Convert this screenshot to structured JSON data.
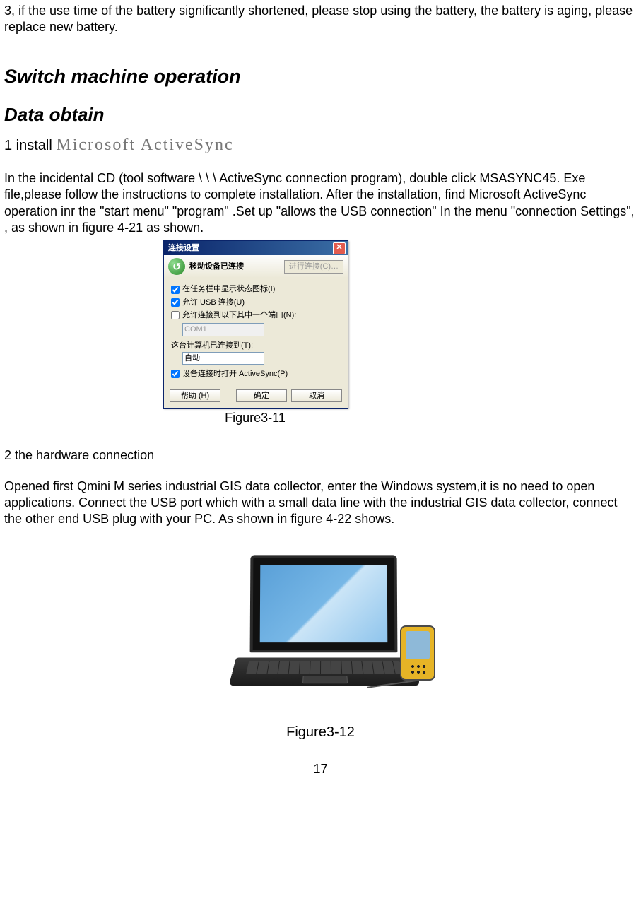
{
  "intro": "3, if the use time of the battery  significantly shortened, please stop using the battery, the battery is aging, please replace new battery.",
  "h1": "Switch machine operation",
  "h1b": "Data  obtain",
  "step1": {
    "prefix": "1 install  ",
    "product": "Microsoft ActiveSync"
  },
  "para1": "In the incidental CD (tool software \\ \\ \\ ActiveSync connection program), double click MSASYNC45. Exe file,please  follow the instructions  to complete installation. After the installation,  find Microsoft ActiveSync operation inr the \"start menu\" \"program\" .Set up \"allows the USB connection\" In the menu \"connection Settings\", , as shown in figure 4-21 as shown.",
  "dialog": {
    "title": "连接设置",
    "status": "移动设备已连接",
    "connect_btn": "进行连接(C)…",
    "opt_tray": "在任务栏中显示状态图标(I)",
    "opt_usb": "允许 USB 连接(U)",
    "opt_port": "允许连接到以下其中一个端口(N):",
    "port_value": "COM1",
    "label_connected": "这台计算机已连接到(T):",
    "connected_value": "自动",
    "opt_open": "设备连接时打开 ActiveSync(P)",
    "btn_help": "帮助 (H)",
    "btn_ok": "确定",
    "btn_cancel": "取消"
  },
  "caption1": "Figure3-11",
  "step2_title": "2  the hardware connection",
  "para2": "Opened first Qmini M series industrial GIS data collector, enter  the Windows system,it is no need to open applications. Connect the USB port which with a small data line with the  industrial GIS data collector, connect the other end USB plug with your PC. As shown in figure 4-22 shows.",
  "caption2": "Figure3-12",
  "page_no": "17"
}
